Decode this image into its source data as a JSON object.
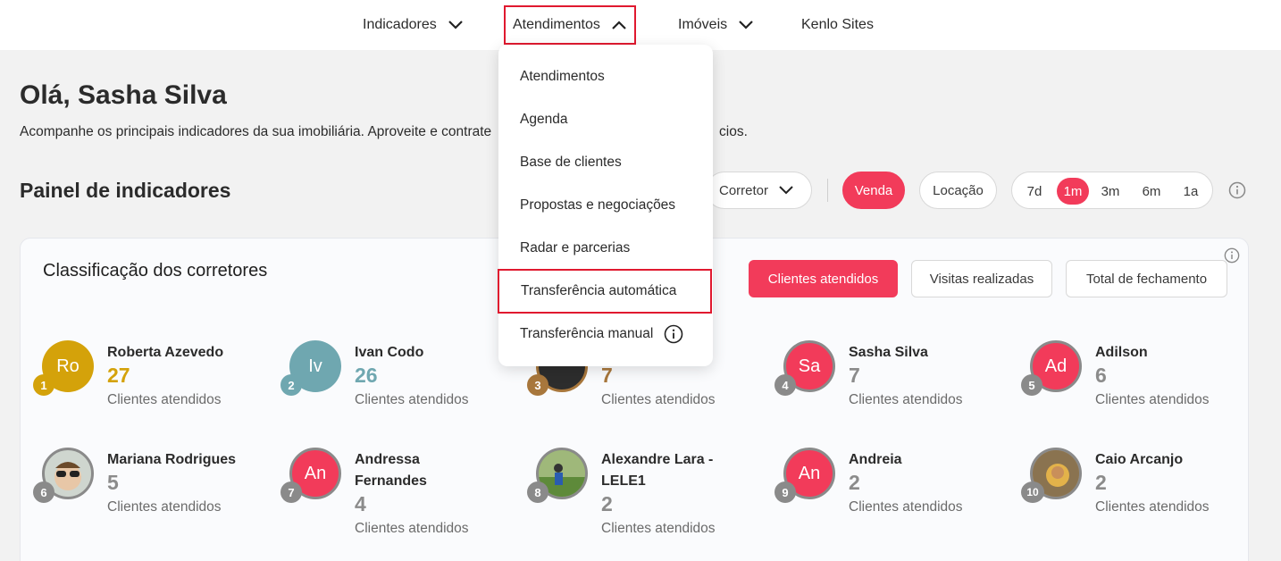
{
  "nav": {
    "items": [
      {
        "label": "Indicadores"
      },
      {
        "label": "Atendimentos"
      },
      {
        "label": "Imóveis"
      },
      {
        "label": "Kenlo Sites"
      }
    ]
  },
  "header": {
    "greeting": "Olá, Sasha Silva",
    "subtitle_left": "Acompanhe os principais indicadores da sua imobiliária. Aproveite e contrate",
    "subtitle_right": "cios."
  },
  "panel": {
    "title": "Painel de indicadores",
    "filters": {
      "corretor": "Corretor",
      "venda": "Venda",
      "locacao": "Locação",
      "periods": [
        "7d",
        "1m",
        "3m",
        "6m",
        "1a"
      ],
      "selected_period": "1m"
    }
  },
  "ranking": {
    "title": "Classificação dos corretores",
    "tabs": [
      "Clientes atendidos",
      "Visitas realizadas",
      "Total de fechamento"
    ],
    "selected_tab": "Clientes atendidos",
    "count_label": "Clientes atendidos",
    "brokers": [
      {
        "rank": "1",
        "initials": "Ro",
        "name": "Roberta Azevedo",
        "count": "27"
      },
      {
        "rank": "2",
        "initials": "Iv",
        "name": "Ivan Codo",
        "count": "26"
      },
      {
        "rank": "3",
        "initials": "",
        "name": "",
        "count": "7"
      },
      {
        "rank": "4",
        "initials": "Sa",
        "name": "Sasha Silva",
        "count": "7"
      },
      {
        "rank": "5",
        "initials": "Ad",
        "name": "Adilson",
        "count": "6"
      },
      {
        "rank": "6",
        "initials": "",
        "name": "Mariana Rodrigues",
        "count": "5"
      },
      {
        "rank": "7",
        "initials": "An",
        "name": "Andressa Fernandes",
        "count": "4"
      },
      {
        "rank": "8",
        "initials": "",
        "name": "Alexandre Lara - LELE1",
        "count": "2"
      },
      {
        "rank": "9",
        "initials": "An",
        "name": "Andreia",
        "count": "2"
      },
      {
        "rank": "10",
        "initials": "",
        "name": "Caio Arcanjo",
        "count": "2"
      }
    ]
  },
  "dropdown": {
    "items": [
      "Atendimentos",
      "Agenda",
      "Base de clientes",
      "Propostas e negociações",
      "Radar e parcerias",
      "Transferência automática",
      "Transferência manual"
    ],
    "highlighted": "Transferência automática"
  },
  "colors": {
    "accent": "#f23b5a",
    "gold": "#d4a20a",
    "teal": "#6fa7b0",
    "bronze": "#a8773c",
    "gray": "#8a8a8a"
  }
}
